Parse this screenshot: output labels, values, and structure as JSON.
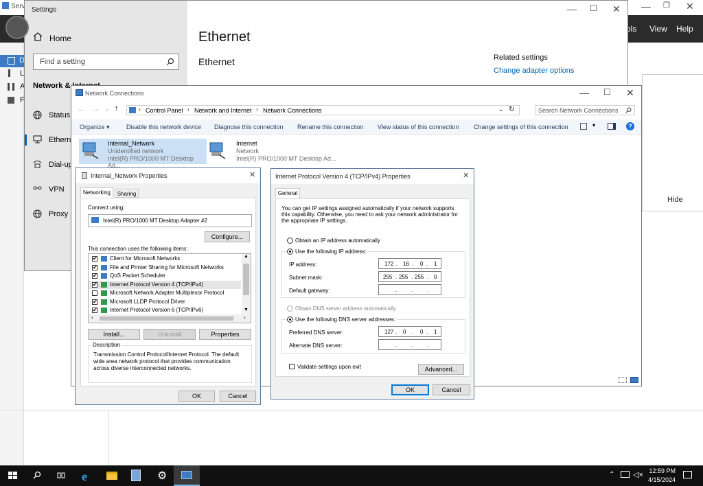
{
  "server_manager": {
    "title": "Serve",
    "menu": [
      "ols",
      "View",
      "Help"
    ],
    "left_letters": [
      "D",
      "L",
      "A",
      "F"
    ],
    "hide_label": "Hide"
  },
  "settings": {
    "window_title": "Settings",
    "home": "Home",
    "search_placeholder": "Find a setting",
    "section": "Network & Internet",
    "nav": [
      "Status",
      "Ethernet",
      "Dial-up",
      "VPN",
      "Proxy"
    ],
    "page_title": "Ethernet",
    "sub_title": "Ethernet",
    "related_heading": "Related settings",
    "related_link": "Change adapter options"
  },
  "network_connections": {
    "window_title": "Network Connections",
    "breadcrumb": [
      "Control Panel",
      "Network and Internet",
      "Network Connections"
    ],
    "search_placeholder": "Search Network Connections",
    "toolbar": {
      "organize": "Organize ▾",
      "disable": "Disable this network device",
      "diagnose": "Diagnose this connection",
      "rename": "Rename this connection",
      "view_status": "View status of this connection",
      "change_settings": "Change settings of this connection"
    },
    "items": [
      {
        "name": "Internal_Network",
        "status": "Unidentified network",
        "adapter": "Intel(R) PRO/1000 MT Desktop Ad..."
      },
      {
        "name": "Internet",
        "status": "Network",
        "adapter": "Intel(R) PRO/1000 MT Desktop Ad..."
      }
    ]
  },
  "properties": {
    "title": "Internal_Network Properties",
    "tabs": [
      "Networking",
      "Sharing"
    ],
    "connect_using_label": "Connect using:",
    "adapter": "Intel(R) PRO/1000 MT Desktop Adapter #2",
    "configure": "Configure...",
    "items_label": "This connection uses the following items:",
    "items": [
      {
        "label": "Client for Microsoft Networks",
        "checked": "✔"
      },
      {
        "label": "File and Printer Sharing for Microsoft Networks",
        "checked": "✔"
      },
      {
        "label": "QoS Packet Scheduler",
        "checked": "✔"
      },
      {
        "label": "Internet Protocol Version 4 (TCP/IPv4)",
        "checked": "✔"
      },
      {
        "label": "Microsoft Network Adapter Multiplexor Protocol",
        "checked": ""
      },
      {
        "label": "Microsoft LLDP Protocol Driver",
        "checked": "✔"
      },
      {
        "label": "Internet Protocol Version 6 (TCP/IPv6)",
        "checked": "✔"
      }
    ],
    "install": "Install...",
    "uninstall": "Uninstall",
    "properties_btn": "Properties",
    "description_label": "Description",
    "description": "Transmission Control Protocol/Internet Protocol. The default wide area network protocol that provides communication across diverse interconnected networks.",
    "ok": "OK",
    "cancel": "Cancel"
  },
  "ipv4": {
    "title": "Internet Protocol Version 4 (TCP/IPv4) Properties",
    "tab": "General",
    "intro": "You can get IP settings assigned automatically if your network supports this capability. Otherwise, you need to ask your network administrator for the appropriate IP settings.",
    "obtain_ip": "Obtain an IP address automatically",
    "use_ip": "Use the following IP address:",
    "ip_label": "IP address:",
    "ip": [
      "172",
      "16",
      "0",
      "1"
    ],
    "mask_label": "Subnet mask:",
    "mask": [
      "255",
      "255",
      "255",
      "0"
    ],
    "gw_label": "Default gateway:",
    "obtain_dns": "Obtain DNS server address automatically",
    "use_dns": "Use the following DNS server addresses:",
    "pdns_label": "Preferred DNS server:",
    "pdns": [
      "127",
      "0",
      "0",
      "1"
    ],
    "adns_label": "Alternate DNS server:",
    "validate": "Validate settings upon exit",
    "advanced": "Advanced...",
    "ok": "OK",
    "cancel": "Cancel"
  },
  "taskbar": {
    "time": "12:59 PM",
    "date": "4/15/2024"
  }
}
